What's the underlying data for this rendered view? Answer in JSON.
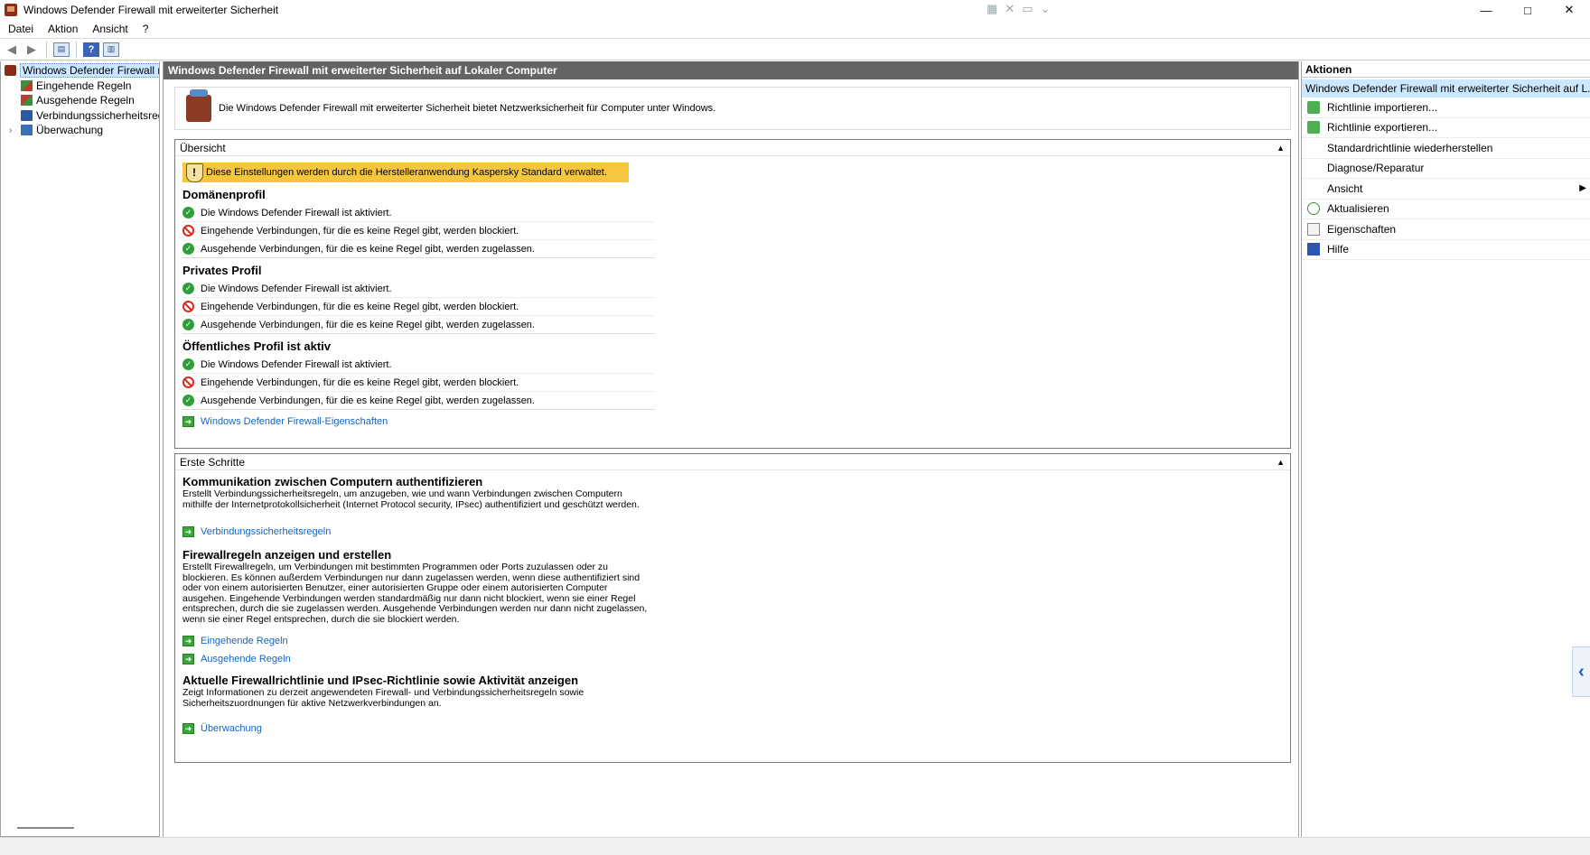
{
  "window": {
    "title": "Windows Defender Firewall mit erweiterter Sicherheit",
    "controls": {
      "minimize": "—",
      "maximize": "□",
      "close": "✕"
    }
  },
  "menu": [
    "Datei",
    "Aktion",
    "Ansicht",
    "?"
  ],
  "tree": [
    {
      "label": "Windows Defender Firewall mit",
      "icon": "firewall-icon",
      "selected": true
    },
    {
      "label": "Eingehende Regeln",
      "icon": "inbound-rules-icon"
    },
    {
      "label": "Ausgehende Regeln",
      "icon": "outbound-rules-icon"
    },
    {
      "label": "Verbindungssicherheitsrege",
      "icon": "connection-security-icon"
    },
    {
      "label": "Überwachung",
      "icon": "monitoring-icon",
      "expandable": true
    }
  ],
  "center": {
    "header": "Windows Defender Firewall mit erweiterter Sicherheit auf Lokaler Computer",
    "intro": "Die Windows Defender Firewall mit erweiterter Sicherheit bietet Netzwerksicherheit für Computer unter Windows.",
    "overview": {
      "title": "Übersicht",
      "warning": "Diese Einstellungen werden durch die Herstelleranwendung Kaspersky Standard verwaltet.",
      "profiles": [
        {
          "title": "Domänenprofil",
          "lines": [
            {
              "status": "ok",
              "text": "Die Windows Defender Firewall ist aktiviert."
            },
            {
              "status": "block",
              "text": "Eingehende Verbindungen, für die es keine Regel gibt, werden blockiert."
            },
            {
              "status": "ok",
              "text": "Ausgehende Verbindungen, für die es keine Regel gibt, werden zugelassen."
            }
          ]
        },
        {
          "title": "Privates Profil",
          "lines": [
            {
              "status": "ok",
              "text": "Die Windows Defender Firewall ist aktiviert."
            },
            {
              "status": "block",
              "text": "Eingehende Verbindungen, für die es keine Regel gibt, werden blockiert."
            },
            {
              "status": "ok",
              "text": "Ausgehende Verbindungen, für die es keine Regel gibt, werden zugelassen."
            }
          ]
        },
        {
          "title": "Öffentliches Profil ist aktiv",
          "lines": [
            {
              "status": "ok",
              "text": "Die Windows Defender Firewall ist aktiviert."
            },
            {
              "status": "block",
              "text": "Eingehende Verbindungen, für die es keine Regel gibt, werden blockiert."
            },
            {
              "status": "ok",
              "text": "Ausgehende Verbindungen, für die es keine Regel gibt, werden zugelassen."
            }
          ]
        }
      ],
      "link": "Windows Defender Firewall-Eigenschaften"
    },
    "getting_started": {
      "title": "Erste Schritte",
      "items": [
        {
          "title": "Kommunikation zwischen Computern authentifizieren",
          "desc": "Erstellt Verbindungssicherheitsregeln, um anzugeben, wie und wann Verbindungen zwischen Computern mithilfe der Internetprotokollsicherheit (Internet Protocol security, IPsec) authentifiziert und geschützt werden.",
          "links": [
            "Verbindungssicherheitsregeln"
          ]
        },
        {
          "title": "Firewallregeln anzeigen und erstellen",
          "desc": "Erstellt Firewallregeln, um Verbindungen mit bestimmten Programmen oder Ports zuzulassen oder zu blockieren. Es können außerdem  Verbindungen nur dann zugelassen werden, wenn diese authentifiziert sind oder von einem autorisierten Benutzer, einer autorisierten Gruppe oder einem autorisierten Computer ausgehen. Eingehende Verbindungen werden standardmäßig nur dann nicht blockiert, wenn sie einer Regel entsprechen, durch die sie zugelassen werden. Ausgehende Verbindungen werden nur dann nicht zugelassen, wenn sie einer Regel entsprechen, durch die sie blockiert werden.",
          "links": [
            "Eingehende Regeln",
            "Ausgehende Regeln"
          ]
        },
        {
          "title": "Aktuelle Firewallrichtlinie und IPsec-Richtlinie sowie Aktivität anzeigen",
          "desc": "Zeigt Informationen zu derzeit angewendeten Firewall- und Verbindungssicherheitsregeln sowie Sicherheitszuordnungen für aktive Netzwerkverbindungen an.",
          "links": [
            "Überwachung"
          ]
        }
      ]
    }
  },
  "actions": {
    "header": "Aktionen",
    "subheader": "Windows Defender Firewall mit erweiterter Sicherheit auf L...",
    "items": [
      {
        "label": "Richtlinie importieren...",
        "icon": "import-icon"
      },
      {
        "label": "Richtlinie exportieren...",
        "icon": "export-icon"
      },
      {
        "label": "Standardrichtlinie wiederherstellen",
        "icon": ""
      },
      {
        "label": "Diagnose/Reparatur",
        "icon": ""
      },
      {
        "label": "Ansicht",
        "icon": "",
        "submenu": true
      },
      {
        "label": "Aktualisieren",
        "icon": "refresh-icon"
      },
      {
        "label": "Eigenschaften",
        "icon": "properties-icon"
      },
      {
        "label": "Hilfe",
        "icon": "help-icon"
      }
    ]
  }
}
